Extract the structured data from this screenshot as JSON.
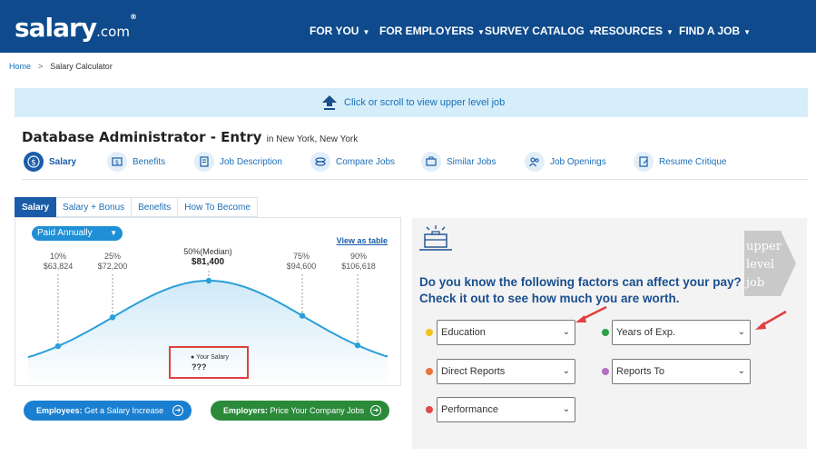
{
  "header": {
    "logo_main": "salary",
    "logo_suffix": ".com",
    "logo_tm": "®",
    "nav": [
      {
        "label": "FOR YOU"
      },
      {
        "label": "FOR EMPLOYERS"
      },
      {
        "label": "SURVEY CATALOG"
      },
      {
        "label": "RESOURCES"
      },
      {
        "label": "FIND A JOB"
      }
    ]
  },
  "breadcrumb": {
    "home": "Home",
    "separator": ">",
    "current": "Salary Calculator"
  },
  "banner": {
    "text": "Click or scroll to view upper level job"
  },
  "job": {
    "title": "Database Administrator - Entry",
    "location": "in New York, New York"
  },
  "subnav": [
    {
      "label": "Salary",
      "icon": "dollar-icon"
    },
    {
      "label": "Benefits",
      "icon": "benefits-icon"
    },
    {
      "label": "Job Description",
      "icon": "document-icon"
    },
    {
      "label": "Compare Jobs",
      "icon": "compare-icon"
    },
    {
      "label": "Similar Jobs",
      "icon": "briefcase-icon"
    },
    {
      "label": "Job Openings",
      "icon": "people-icon"
    },
    {
      "label": "Resume Critique",
      "icon": "resume-icon"
    }
  ],
  "tabs": [
    "Salary",
    "Salary + Bonus",
    "Benefits",
    "How To Become"
  ],
  "chart_panel": {
    "paid_select": "Paid Annually",
    "view_as_table": "View as table",
    "your_salary_label": "Your Salary",
    "your_salary_value": "???"
  },
  "chart_data": {
    "type": "line",
    "x": [
      "10%",
      "25%",
      "50%(Median)",
      "75%",
      "90%"
    ],
    "values": [
      63824,
      72200,
      81400,
      94600,
      106618
    ],
    "value_labels": [
      "$63,824",
      "$72,200",
      "$81,400",
      "$94,600",
      "$106,618"
    ],
    "grid": false
  },
  "buttons": {
    "employees": {
      "bold": "Employees:",
      "text": " Get a Salary Increase"
    },
    "employers": {
      "bold": "Employers:",
      "text": " Price Your Company Jobs"
    }
  },
  "factors": {
    "question": "Do you know the following factors can affect your pay? Check it out to see how much you are worth.",
    "upper_level": [
      "upper",
      "level",
      "job"
    ],
    "selects": [
      {
        "label": "Education",
        "dot_color": "#f2c31a"
      },
      {
        "label": "Years of Exp.",
        "dot_color": "#2e9e48"
      },
      {
        "label": "Direct Reports",
        "dot_color": "#e8743b"
      },
      {
        "label": "Reports To",
        "dot_color": "#b46fc1"
      },
      {
        "label": "Performance",
        "dot_color": "#e04a4a"
      }
    ]
  },
  "colors": {
    "brand": "#0e4a8c",
    "accent": "#1a5ca8",
    "curve": "#2a9fd8",
    "highlight": "#e04040",
    "employees_btn": "#1a7fd0",
    "employers_btn": "#2a8a3a"
  }
}
